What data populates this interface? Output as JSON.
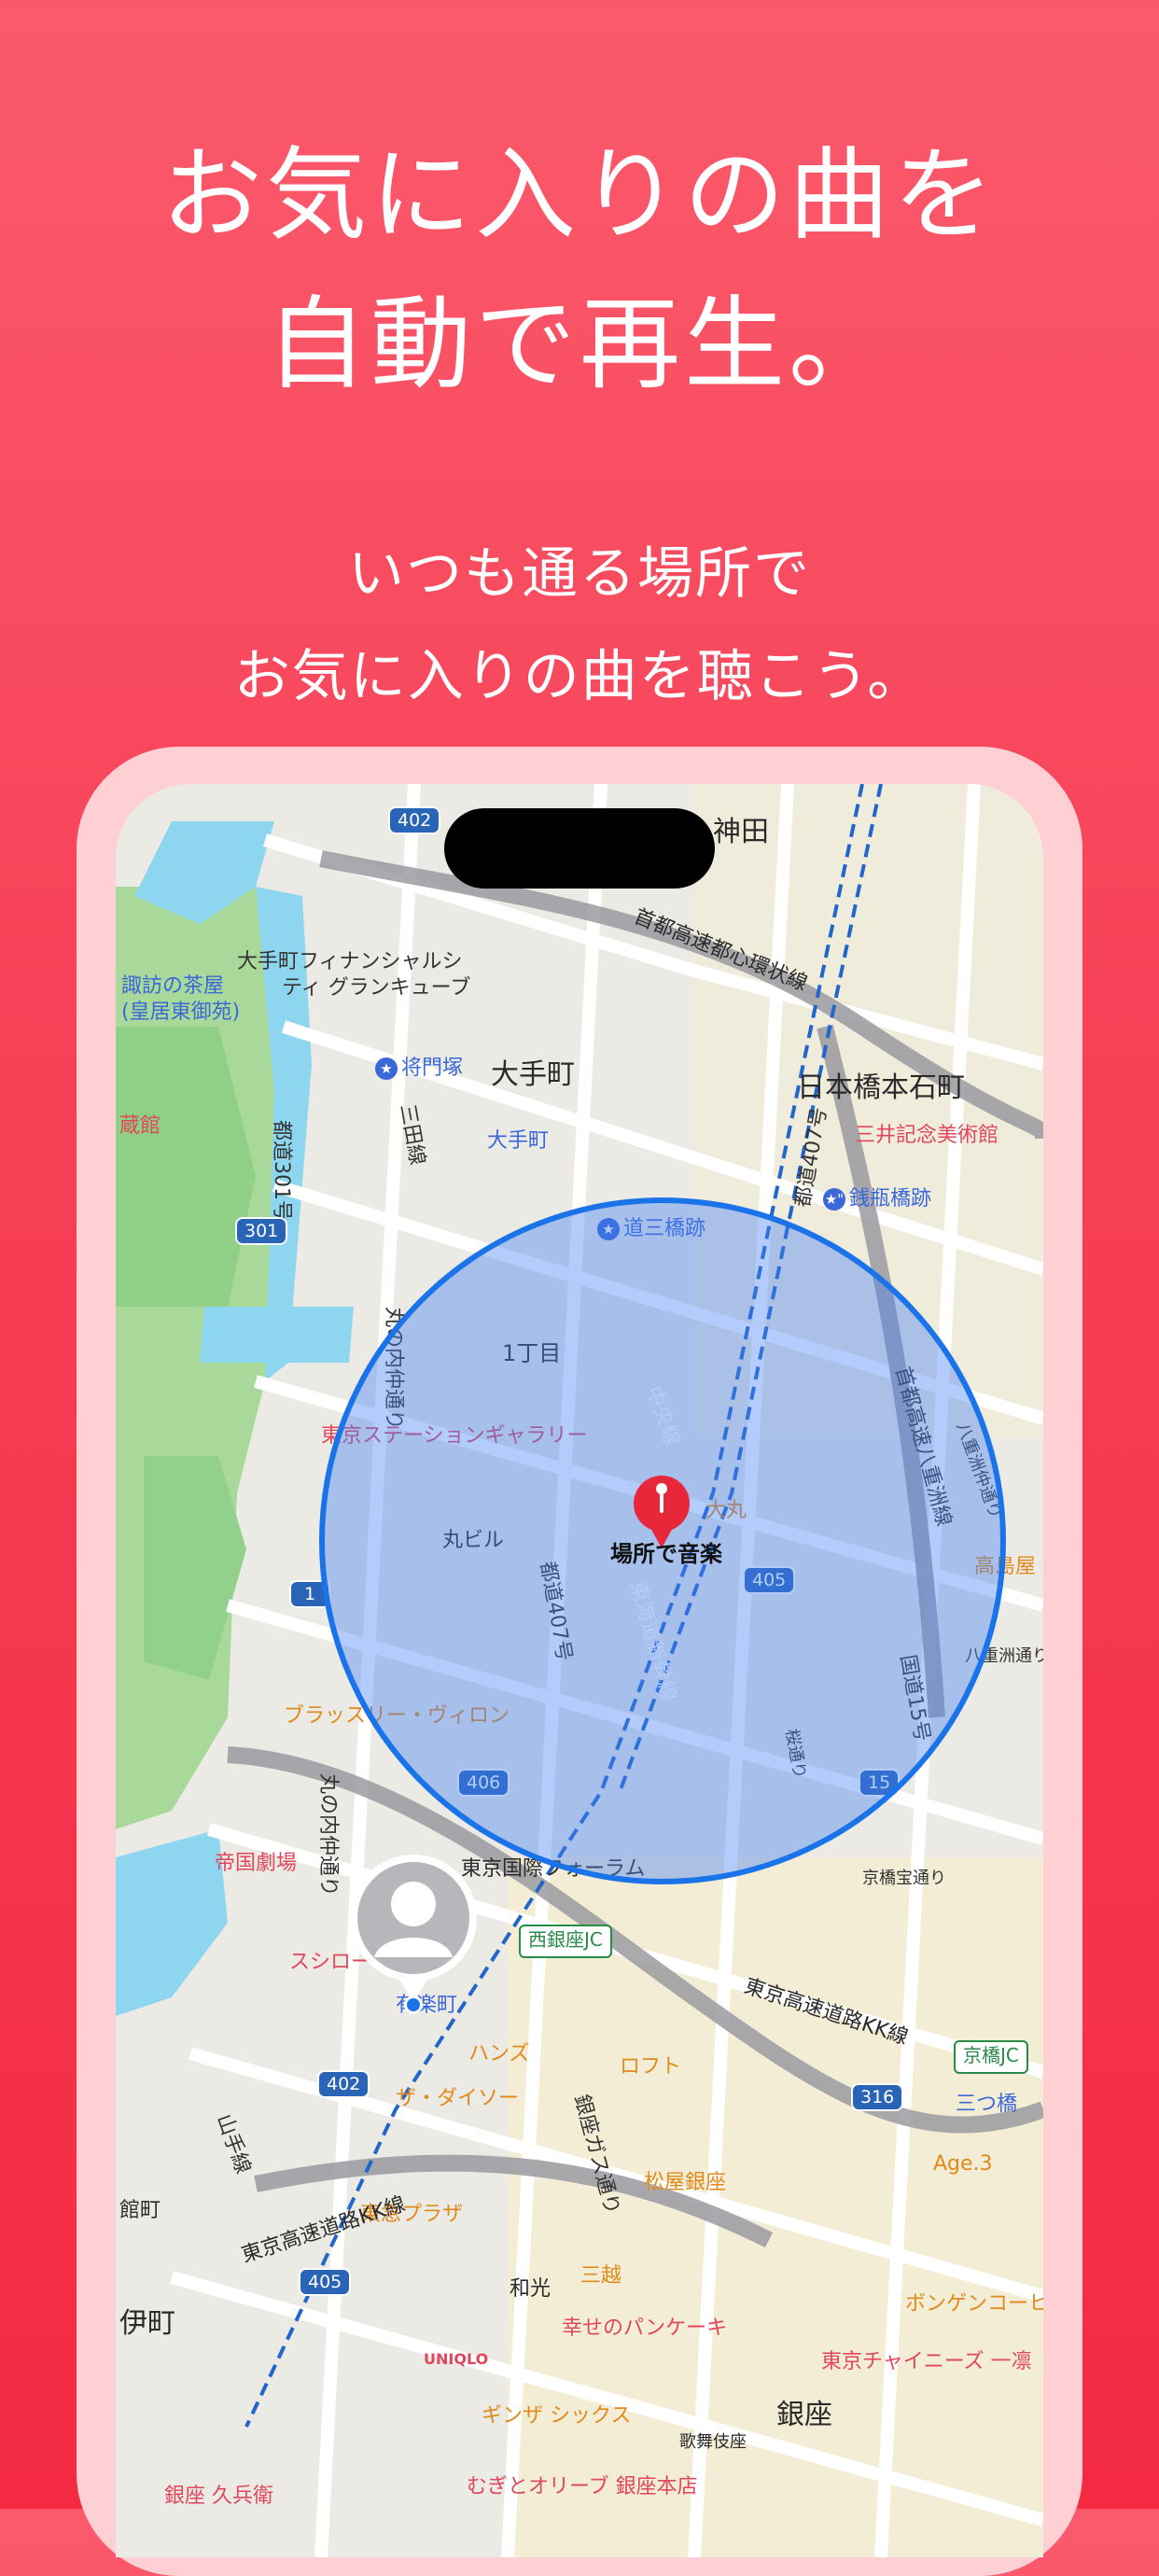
{
  "headline": {
    "line1": "お気に入りの曲を",
    "line2": "自動で再生。"
  },
  "subheadline": {
    "line1": "いつも通る場所で",
    "line2": "お気に入りの曲を聴こう。"
  },
  "map": {
    "pin_label": "場所で音楽",
    "labels": {
      "kanda": "神田",
      "tokyo_financial": "大手町フィナンシャルシ",
      "tokyo_financial2": "ティ グランキューブ",
      "suwa": "諏訪の茶屋",
      "suwa2": "(皇居東御苑)",
      "shuto_toshin": "首都高速都心環状線",
      "masakado": "将門塚",
      "otemachi_big": "大手町",
      "otemachi_station": "大手町",
      "nihonbashi": "日本橋本石町",
      "mitsui": "三井記念美術館",
      "zeni": "銭瓶橋跡",
      "dosan": "道三橋跡",
      "toko_road": "都道301号",
      "mita": "三田線",
      "toko407": "都道407号",
      "itchome": "1丁目",
      "marunouchi_naka": "丸の内仲通り",
      "chuo_line": "中央線",
      "yaesu_line": "首都高速八重洲線",
      "tokyo_station_gallery": "東京ステーションギャラリー",
      "daimaru": "大丸",
      "marubiru": "丸ビル",
      "takashimaya": "高島屋",
      "tokaido": "東海道新幹線",
      "toko407b": "都道407号",
      "yaesu_naka": "八重洲仲通り",
      "yaesu_dori": "八重洲通り",
      "kokudo15": "国道15号",
      "sakura": "桜通り",
      "brasserie": "ブラッスリー・ヴィロン",
      "teigeki": "帝国劇場",
      "forum": "東京国際フォーラム",
      "kyobashi_dori": "京橋宝通り",
      "marunouchi_naka2": "丸の内仲通り",
      "sushiro": "スシロー",
      "yurakucho": "有楽町",
      "kk_line": "東京高速道路KK線",
      "hands": "ハンズ",
      "loft": "ロフト",
      "daiso": "ザ・ダイソー",
      "matsuya": "松屋銀座",
      "ginza_kanemu": "銀座ガス通り",
      "tokyu_plaza": "東急プラザ",
      "age3": "Age.3",
      "kk_line2": "東京高速道路KK線",
      "mitsu": "三つ橋",
      "wako": "和光",
      "mitsukoshi": "三越",
      "pancake": "幸せのパンケーキ",
      "bongen": "ボンゲンコーヒ",
      "chinese": "東京チャイニーズ 一凛",
      "uniqlo": "UNIQLO",
      "ginza_six": "ギンザ シックス",
      "kabukiza": "歌舞伎座",
      "ginza": "銀座",
      "olive": "むぎとオリーブ 銀座本店",
      "kyubey": "銀座 久兵衛",
      "yamanote": "山手線",
      "kanmachi": "館町",
      "ito": "伊町",
      "zo": "蔵館"
    },
    "shields": {
      "r402a": "402",
      "r301": "301",
      "r1": "1",
      "r405a": "405",
      "r406": "406",
      "r15": "15",
      "r402b": "402",
      "r316": "316",
      "r405b": "405"
    },
    "junctions": {
      "nishi": "西銀座JC",
      "kyo": "京橋JC"
    }
  },
  "colors": {
    "accent": "#f63f55",
    "circle": "#1a73e8",
    "pin": "#e8283a"
  }
}
